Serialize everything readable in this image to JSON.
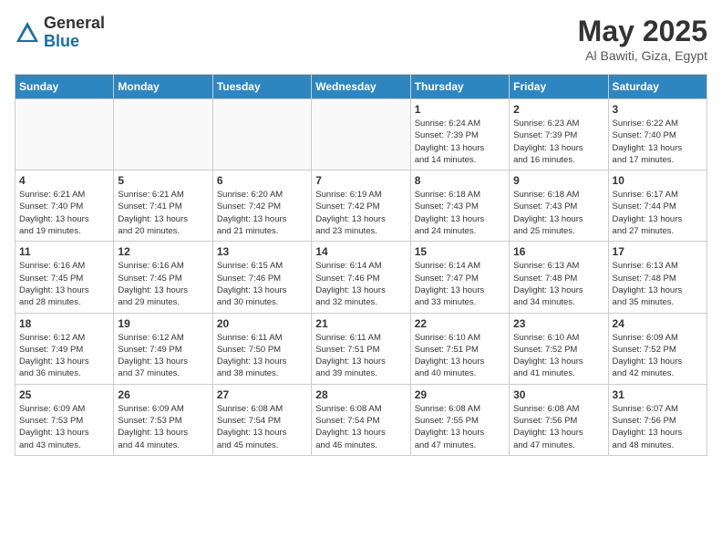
{
  "header": {
    "logo_general": "General",
    "logo_blue": "Blue",
    "month_title": "May 2025",
    "location": "Al Bawiti, Giza, Egypt"
  },
  "days_of_week": [
    "Sunday",
    "Monday",
    "Tuesday",
    "Wednesday",
    "Thursday",
    "Friday",
    "Saturday"
  ],
  "weeks": [
    [
      {
        "day": "",
        "info": ""
      },
      {
        "day": "",
        "info": ""
      },
      {
        "day": "",
        "info": ""
      },
      {
        "day": "",
        "info": ""
      },
      {
        "day": "1",
        "info": "Sunrise: 6:24 AM\nSunset: 7:39 PM\nDaylight: 13 hours\nand 14 minutes."
      },
      {
        "day": "2",
        "info": "Sunrise: 6:23 AM\nSunset: 7:39 PM\nDaylight: 13 hours\nand 16 minutes."
      },
      {
        "day": "3",
        "info": "Sunrise: 6:22 AM\nSunset: 7:40 PM\nDaylight: 13 hours\nand 17 minutes."
      }
    ],
    [
      {
        "day": "4",
        "info": "Sunrise: 6:21 AM\nSunset: 7:40 PM\nDaylight: 13 hours\nand 19 minutes."
      },
      {
        "day": "5",
        "info": "Sunrise: 6:21 AM\nSunset: 7:41 PM\nDaylight: 13 hours\nand 20 minutes."
      },
      {
        "day": "6",
        "info": "Sunrise: 6:20 AM\nSunset: 7:42 PM\nDaylight: 13 hours\nand 21 minutes."
      },
      {
        "day": "7",
        "info": "Sunrise: 6:19 AM\nSunset: 7:42 PM\nDaylight: 13 hours\nand 23 minutes."
      },
      {
        "day": "8",
        "info": "Sunrise: 6:18 AM\nSunset: 7:43 PM\nDaylight: 13 hours\nand 24 minutes."
      },
      {
        "day": "9",
        "info": "Sunrise: 6:18 AM\nSunset: 7:43 PM\nDaylight: 13 hours\nand 25 minutes."
      },
      {
        "day": "10",
        "info": "Sunrise: 6:17 AM\nSunset: 7:44 PM\nDaylight: 13 hours\nand 27 minutes."
      }
    ],
    [
      {
        "day": "11",
        "info": "Sunrise: 6:16 AM\nSunset: 7:45 PM\nDaylight: 13 hours\nand 28 minutes."
      },
      {
        "day": "12",
        "info": "Sunrise: 6:16 AM\nSunset: 7:45 PM\nDaylight: 13 hours\nand 29 minutes."
      },
      {
        "day": "13",
        "info": "Sunrise: 6:15 AM\nSunset: 7:46 PM\nDaylight: 13 hours\nand 30 minutes."
      },
      {
        "day": "14",
        "info": "Sunrise: 6:14 AM\nSunset: 7:46 PM\nDaylight: 13 hours\nand 32 minutes."
      },
      {
        "day": "15",
        "info": "Sunrise: 6:14 AM\nSunset: 7:47 PM\nDaylight: 13 hours\nand 33 minutes."
      },
      {
        "day": "16",
        "info": "Sunrise: 6:13 AM\nSunset: 7:48 PM\nDaylight: 13 hours\nand 34 minutes."
      },
      {
        "day": "17",
        "info": "Sunrise: 6:13 AM\nSunset: 7:48 PM\nDaylight: 13 hours\nand 35 minutes."
      }
    ],
    [
      {
        "day": "18",
        "info": "Sunrise: 6:12 AM\nSunset: 7:49 PM\nDaylight: 13 hours\nand 36 minutes."
      },
      {
        "day": "19",
        "info": "Sunrise: 6:12 AM\nSunset: 7:49 PM\nDaylight: 13 hours\nand 37 minutes."
      },
      {
        "day": "20",
        "info": "Sunrise: 6:11 AM\nSunset: 7:50 PM\nDaylight: 13 hours\nand 38 minutes."
      },
      {
        "day": "21",
        "info": "Sunrise: 6:11 AM\nSunset: 7:51 PM\nDaylight: 13 hours\nand 39 minutes."
      },
      {
        "day": "22",
        "info": "Sunrise: 6:10 AM\nSunset: 7:51 PM\nDaylight: 13 hours\nand 40 minutes."
      },
      {
        "day": "23",
        "info": "Sunrise: 6:10 AM\nSunset: 7:52 PM\nDaylight: 13 hours\nand 41 minutes."
      },
      {
        "day": "24",
        "info": "Sunrise: 6:09 AM\nSunset: 7:52 PM\nDaylight: 13 hours\nand 42 minutes."
      }
    ],
    [
      {
        "day": "25",
        "info": "Sunrise: 6:09 AM\nSunset: 7:53 PM\nDaylight: 13 hours\nand 43 minutes."
      },
      {
        "day": "26",
        "info": "Sunrise: 6:09 AM\nSunset: 7:53 PM\nDaylight: 13 hours\nand 44 minutes."
      },
      {
        "day": "27",
        "info": "Sunrise: 6:08 AM\nSunset: 7:54 PM\nDaylight: 13 hours\nand 45 minutes."
      },
      {
        "day": "28",
        "info": "Sunrise: 6:08 AM\nSunset: 7:54 PM\nDaylight: 13 hours\nand 46 minutes."
      },
      {
        "day": "29",
        "info": "Sunrise: 6:08 AM\nSunset: 7:55 PM\nDaylight: 13 hours\nand 47 minutes."
      },
      {
        "day": "30",
        "info": "Sunrise: 6:08 AM\nSunset: 7:56 PM\nDaylight: 13 hours\nand 47 minutes."
      },
      {
        "day": "31",
        "info": "Sunrise: 6:07 AM\nSunset: 7:56 PM\nDaylight: 13 hours\nand 48 minutes."
      }
    ]
  ]
}
